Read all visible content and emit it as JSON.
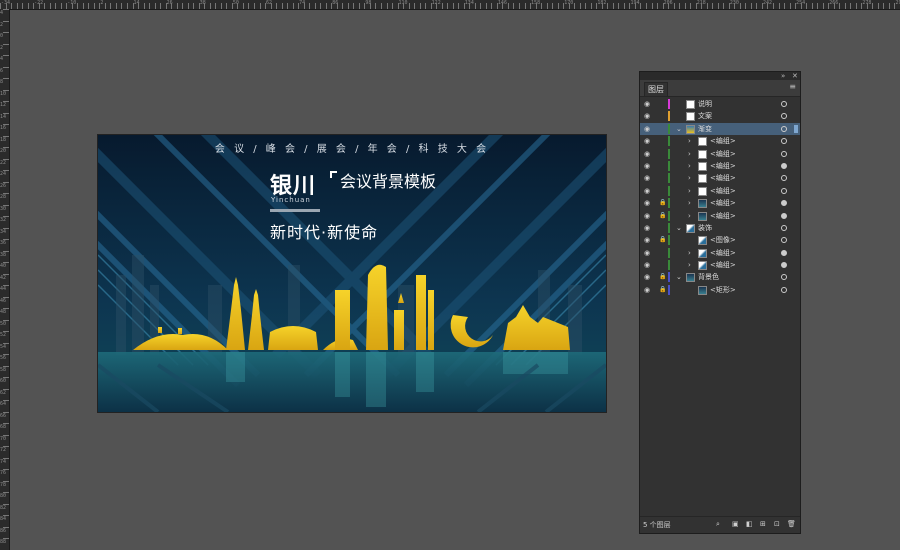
{
  "ruler": {
    "top_labels": [
      "-34",
      "-32",
      "-30",
      "-28",
      "-26",
      "-24",
      "-22",
      "-20",
      "-18",
      "-16",
      "-14",
      "-12",
      "-10",
      "-8",
      "-6",
      "-4",
      "-2",
      "0",
      "2",
      "4",
      "6",
      "8",
      "10",
      "12",
      "14",
      "16",
      "18",
      "20",
      "22",
      "24",
      "26",
      "28",
      "30",
      "32",
      "34",
      "36",
      "38",
      "40",
      "42",
      "44",
      "46",
      "48",
      "50",
      "52",
      "54",
      "56",
      "58",
      "60",
      "62",
      "64",
      "66",
      "68",
      "70",
      "72",
      "74",
      "76",
      "78",
      "80",
      "82",
      "84",
      "86",
      "88",
      "90",
      "92",
      "94",
      "96",
      "98",
      "100",
      "102",
      "104",
      "106",
      "108",
      "110",
      "112",
      "114",
      "116",
      "118",
      "120",
      "122",
      "124",
      "126",
      "128",
      "130",
      "132",
      "134",
      "136",
      "138",
      "140",
      "142",
      "144",
      "146",
      "148",
      "150",
      "152",
      "154",
      "156",
      "158",
      "160",
      "162",
      "164",
      "166",
      "168",
      "170",
      "172",
      "174",
      "176",
      "178",
      "180",
      "182",
      "184",
      "186",
      "188",
      "190",
      "192",
      "194",
      "196",
      "198",
      "200",
      "202",
      "204",
      "206",
      "208",
      "210",
      "212",
      "214",
      "216",
      "218",
      "220",
      "222",
      "224",
      "226",
      "228",
      "230",
      "232",
      "234",
      "236",
      "238",
      "240",
      "242",
      "244",
      "246",
      "248",
      "250",
      "252",
      "254",
      "256",
      "258",
      "260",
      "262",
      "264",
      "266",
      "268",
      "270",
      "272",
      "274",
      "276",
      "278",
      "280",
      "282",
      "284",
      "286",
      "288",
      "290"
    ],
    "left_labels": [
      "4",
      "2",
      "0",
      "2",
      "4",
      "6",
      "8",
      "10",
      "12",
      "14",
      "16",
      "18",
      "20",
      "22",
      "24",
      "26",
      "28",
      "30",
      "32",
      "34",
      "36",
      "38",
      "40",
      "42",
      "44",
      "46",
      "48",
      "50",
      "52",
      "54",
      "56",
      "58",
      "60",
      "62",
      "64",
      "66",
      "68",
      "70",
      "72",
      "74",
      "76",
      "78",
      "80",
      "82",
      "84",
      "86",
      "88"
    ]
  },
  "artboard": {
    "top_line": "会 议   /   峰 会   /   展 会   /   年 会   /   科 技 大 会",
    "title_main": "银川",
    "title_en": "Yinchuan",
    "title_right": "会议背景模板",
    "slogan": "新时代·新使命"
  },
  "panel": {
    "tab": "图层",
    "footer_count": "5 个图层",
    "layers": [
      {
        "label": "说明",
        "color": "#d83ad8",
        "indent": 0,
        "arrow": "",
        "lock": false,
        "selected": false,
        "target": "empty",
        "thumb": "white"
      },
      {
        "label": "文案",
        "color": "#e0a030",
        "indent": 0,
        "arrow": "",
        "lock": false,
        "selected": false,
        "target": "empty",
        "thumb": "white"
      },
      {
        "label": "渐变",
        "color": "#3a8a3a",
        "indent": 0,
        "arrow": "v",
        "lock": false,
        "selected": true,
        "target": "empty",
        "thumb": "grad"
      },
      {
        "label": "<编组>",
        "color": "#3a8a3a",
        "indent": 1,
        "arrow": ">",
        "lock": false,
        "selected": false,
        "target": "empty",
        "thumb": "white"
      },
      {
        "label": "<编组>",
        "color": "#3a8a3a",
        "indent": 1,
        "arrow": ">",
        "lock": false,
        "selected": false,
        "target": "empty",
        "thumb": "white"
      },
      {
        "label": "<编组>",
        "color": "#3a8a3a",
        "indent": 1,
        "arrow": ">",
        "lock": false,
        "selected": false,
        "target": "filled",
        "thumb": "white"
      },
      {
        "label": "<编组>",
        "color": "#3a8a3a",
        "indent": 1,
        "arrow": ">",
        "lock": false,
        "selected": false,
        "target": "empty",
        "thumb": "white"
      },
      {
        "label": "<编组>",
        "color": "#3a8a3a",
        "indent": 1,
        "arrow": ">",
        "lock": false,
        "selected": false,
        "target": "empty",
        "thumb": "white"
      },
      {
        "label": "<编组>",
        "color": "#3a8a3a",
        "indent": 1,
        "arrow": ">",
        "lock": true,
        "selected": false,
        "target": "filled",
        "thumb": "dark"
      },
      {
        "label": "<编组>",
        "color": "#3a8a3a",
        "indent": 1,
        "arrow": ">",
        "lock": true,
        "selected": false,
        "target": "filled",
        "thumb": "dark"
      },
      {
        "label": "装饰",
        "color": "#3a8a3a",
        "indent": 0,
        "arrow": "v",
        "lock": false,
        "selected": false,
        "target": "empty",
        "thumb": "deco"
      },
      {
        "label": "<图像>",
        "color": "#3a8a3a",
        "indent": 1,
        "arrow": "",
        "lock": true,
        "selected": false,
        "target": "empty",
        "thumb": "deco"
      },
      {
        "label": "<编组>",
        "color": "#3a8a3a",
        "indent": 1,
        "arrow": ">",
        "lock": false,
        "selected": false,
        "target": "filled",
        "thumb": "deco"
      },
      {
        "label": "<编组>",
        "color": "#3a8a3a",
        "indent": 1,
        "arrow": ">",
        "lock": false,
        "selected": false,
        "target": "filled",
        "thumb": "deco"
      },
      {
        "label": "背景色",
        "color": "#4a50c8",
        "indent": 0,
        "arrow": "v",
        "lock": true,
        "selected": false,
        "target": "empty",
        "thumb": "dark"
      },
      {
        "label": "<矩形>",
        "color": "#4a50c8",
        "indent": 1,
        "arrow": "",
        "lock": true,
        "selected": false,
        "target": "empty",
        "thumb": "dark"
      }
    ]
  }
}
